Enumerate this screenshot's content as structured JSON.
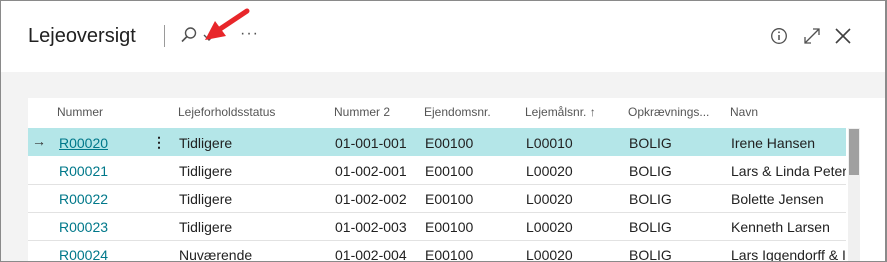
{
  "title": "Lejeoversigt",
  "icons": {
    "search": "search-icon",
    "chevron": "chevron-down-icon",
    "more": "more-icon",
    "info": "info-icon",
    "expand": "expand-icon",
    "close": "close-icon",
    "arrow": "red-arrow-annotation"
  },
  "more_label": "···",
  "columns": [
    "Nummer",
    "Lejeforholdsstatus",
    "Nummer 2",
    "Ejendomsnr.",
    "Lejemålsnr. ↑",
    "Opkrævnings...",
    "Navn"
  ],
  "row_indicator": "→",
  "row_menu": "⋮",
  "rows": [
    [
      "R00020",
      "Tidligere",
      "01-001-001",
      "E00100",
      "L00010",
      "BOLIG",
      "Irene Hansen"
    ],
    [
      "R00021",
      "Tidligere",
      "01-002-001",
      "E00100",
      "L00020",
      "BOLIG",
      "Lars & Linda Peters"
    ],
    [
      "R00022",
      "Tidligere",
      "01-002-002",
      "E00100",
      "L00020",
      "BOLIG",
      "Bolette Jensen"
    ],
    [
      "R00023",
      "Tidligere",
      "01-002-003",
      "E00100",
      "L00020",
      "BOLIG",
      "Kenneth Larsen"
    ],
    [
      "R00024",
      "Nuværende",
      "01-002-004",
      "E00100",
      "L00020",
      "BOLIG",
      "Lars Iggendorff & I"
    ]
  ],
  "colors": {
    "selected_row": "#b4e6e8",
    "link": "#00788a",
    "annotation": "#e8262a"
  }
}
